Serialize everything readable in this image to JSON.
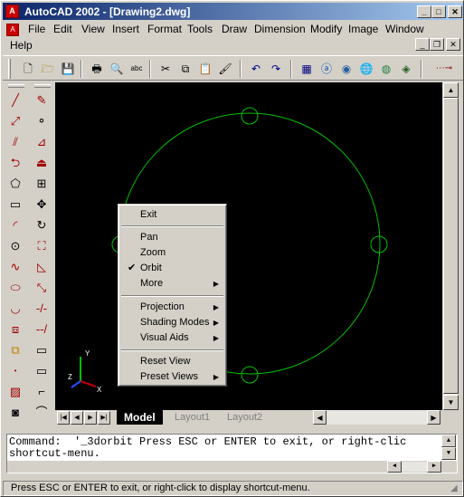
{
  "window": {
    "title": "AutoCAD 2002 - [Drawing2.dwg]"
  },
  "menus": [
    "File",
    "Edit",
    "View",
    "Insert",
    "Format",
    "Tools",
    "Draw",
    "Dimension",
    "Modify",
    "Image",
    "Window",
    "Help"
  ],
  "toolbar": {
    "icons": [
      "new-icon",
      "open-icon",
      "save-icon",
      "print-icon",
      "print-preview-icon",
      "spell-check-icon",
      "cut-icon",
      "copy-icon",
      "paste-icon",
      "match-properties-icon",
      "undo-icon",
      "redo-icon",
      "properties-icon",
      "design-center-icon",
      "today-icon",
      "web-icon",
      "meet-now-icon",
      "nav-icon",
      "ucs-icon"
    ]
  },
  "context_menu": {
    "items": [
      {
        "label": "Exit",
        "checked": false,
        "submenu": false
      },
      {
        "label": "Pan",
        "checked": false,
        "submenu": false
      },
      {
        "label": "Zoom",
        "checked": false,
        "submenu": false
      },
      {
        "label": "Orbit",
        "checked": true,
        "submenu": false
      },
      {
        "label": "More",
        "checked": false,
        "submenu": true
      },
      {
        "label": "Projection",
        "checked": false,
        "submenu": true
      },
      {
        "label": "Shading Modes",
        "checked": false,
        "submenu": true
      },
      {
        "label": "Visual Aids",
        "checked": false,
        "submenu": true
      },
      {
        "label": "Reset View",
        "checked": false,
        "submenu": false
      },
      {
        "label": "Preset Views",
        "checked": false,
        "submenu": true
      }
    ]
  },
  "tabs": [
    "Model",
    "Layout1",
    "Layout2"
  ],
  "ucs": {
    "x_label": "X",
    "y_label": "Y",
    "z_label": "Z"
  },
  "command": {
    "line1": "Command:  '_3dorbit Press ESC or ENTER to exit, or right-clic",
    "line2": "shortcut-menu."
  },
  "status": {
    "text": "Press ESC or ENTER to exit, or right-click to display shortcut-menu."
  },
  "colors": {
    "canvas": "#000000",
    "orbit": "#00c000",
    "title_start": "#0a246a",
    "title_end": "#a6caf0"
  }
}
